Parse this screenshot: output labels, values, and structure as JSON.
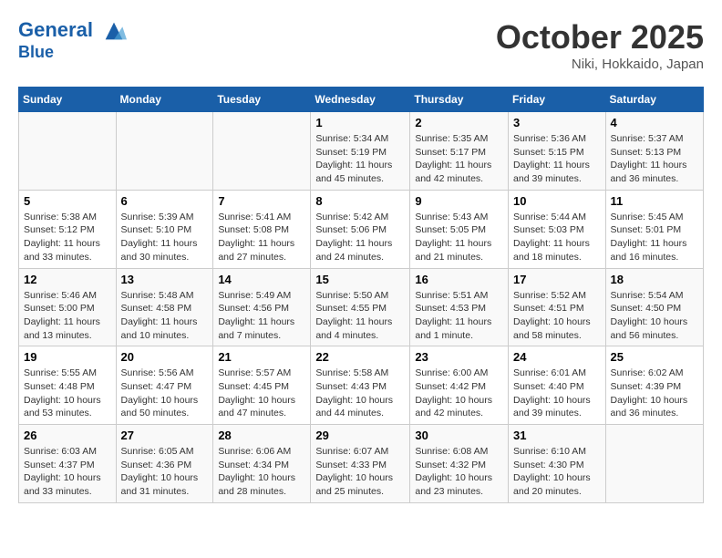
{
  "logo": {
    "line1": "General",
    "line2": "Blue"
  },
  "title": "October 2025",
  "subtitle": "Niki, Hokkaido, Japan",
  "headers": [
    "Sunday",
    "Monday",
    "Tuesday",
    "Wednesday",
    "Thursday",
    "Friday",
    "Saturday"
  ],
  "weeks": [
    [
      {
        "day": "",
        "info": ""
      },
      {
        "day": "",
        "info": ""
      },
      {
        "day": "",
        "info": ""
      },
      {
        "day": "1",
        "info": "Sunrise: 5:34 AM\nSunset: 5:19 PM\nDaylight: 11 hours and 45 minutes."
      },
      {
        "day": "2",
        "info": "Sunrise: 5:35 AM\nSunset: 5:17 PM\nDaylight: 11 hours and 42 minutes."
      },
      {
        "day": "3",
        "info": "Sunrise: 5:36 AM\nSunset: 5:15 PM\nDaylight: 11 hours and 39 minutes."
      },
      {
        "day": "4",
        "info": "Sunrise: 5:37 AM\nSunset: 5:13 PM\nDaylight: 11 hours and 36 minutes."
      }
    ],
    [
      {
        "day": "5",
        "info": "Sunrise: 5:38 AM\nSunset: 5:12 PM\nDaylight: 11 hours and 33 minutes."
      },
      {
        "day": "6",
        "info": "Sunrise: 5:39 AM\nSunset: 5:10 PM\nDaylight: 11 hours and 30 minutes."
      },
      {
        "day": "7",
        "info": "Sunrise: 5:41 AM\nSunset: 5:08 PM\nDaylight: 11 hours and 27 minutes."
      },
      {
        "day": "8",
        "info": "Sunrise: 5:42 AM\nSunset: 5:06 PM\nDaylight: 11 hours and 24 minutes."
      },
      {
        "day": "9",
        "info": "Sunrise: 5:43 AM\nSunset: 5:05 PM\nDaylight: 11 hours and 21 minutes."
      },
      {
        "day": "10",
        "info": "Sunrise: 5:44 AM\nSunset: 5:03 PM\nDaylight: 11 hours and 18 minutes."
      },
      {
        "day": "11",
        "info": "Sunrise: 5:45 AM\nSunset: 5:01 PM\nDaylight: 11 hours and 16 minutes."
      }
    ],
    [
      {
        "day": "12",
        "info": "Sunrise: 5:46 AM\nSunset: 5:00 PM\nDaylight: 11 hours and 13 minutes."
      },
      {
        "day": "13",
        "info": "Sunrise: 5:48 AM\nSunset: 4:58 PM\nDaylight: 11 hours and 10 minutes."
      },
      {
        "day": "14",
        "info": "Sunrise: 5:49 AM\nSunset: 4:56 PM\nDaylight: 11 hours and 7 minutes."
      },
      {
        "day": "15",
        "info": "Sunrise: 5:50 AM\nSunset: 4:55 PM\nDaylight: 11 hours and 4 minutes."
      },
      {
        "day": "16",
        "info": "Sunrise: 5:51 AM\nSunset: 4:53 PM\nDaylight: 11 hours and 1 minute."
      },
      {
        "day": "17",
        "info": "Sunrise: 5:52 AM\nSunset: 4:51 PM\nDaylight: 10 hours and 58 minutes."
      },
      {
        "day": "18",
        "info": "Sunrise: 5:54 AM\nSunset: 4:50 PM\nDaylight: 10 hours and 56 minutes."
      }
    ],
    [
      {
        "day": "19",
        "info": "Sunrise: 5:55 AM\nSunset: 4:48 PM\nDaylight: 10 hours and 53 minutes."
      },
      {
        "day": "20",
        "info": "Sunrise: 5:56 AM\nSunset: 4:47 PM\nDaylight: 10 hours and 50 minutes."
      },
      {
        "day": "21",
        "info": "Sunrise: 5:57 AM\nSunset: 4:45 PM\nDaylight: 10 hours and 47 minutes."
      },
      {
        "day": "22",
        "info": "Sunrise: 5:58 AM\nSunset: 4:43 PM\nDaylight: 10 hours and 44 minutes."
      },
      {
        "day": "23",
        "info": "Sunrise: 6:00 AM\nSunset: 4:42 PM\nDaylight: 10 hours and 42 minutes."
      },
      {
        "day": "24",
        "info": "Sunrise: 6:01 AM\nSunset: 4:40 PM\nDaylight: 10 hours and 39 minutes."
      },
      {
        "day": "25",
        "info": "Sunrise: 6:02 AM\nSunset: 4:39 PM\nDaylight: 10 hours and 36 minutes."
      }
    ],
    [
      {
        "day": "26",
        "info": "Sunrise: 6:03 AM\nSunset: 4:37 PM\nDaylight: 10 hours and 33 minutes."
      },
      {
        "day": "27",
        "info": "Sunrise: 6:05 AM\nSunset: 4:36 PM\nDaylight: 10 hours and 31 minutes."
      },
      {
        "day": "28",
        "info": "Sunrise: 6:06 AM\nSunset: 4:34 PM\nDaylight: 10 hours and 28 minutes."
      },
      {
        "day": "29",
        "info": "Sunrise: 6:07 AM\nSunset: 4:33 PM\nDaylight: 10 hours and 25 minutes."
      },
      {
        "day": "30",
        "info": "Sunrise: 6:08 AM\nSunset: 4:32 PM\nDaylight: 10 hours and 23 minutes."
      },
      {
        "day": "31",
        "info": "Sunrise: 6:10 AM\nSunset: 4:30 PM\nDaylight: 10 hours and 20 minutes."
      },
      {
        "day": "",
        "info": ""
      }
    ]
  ]
}
